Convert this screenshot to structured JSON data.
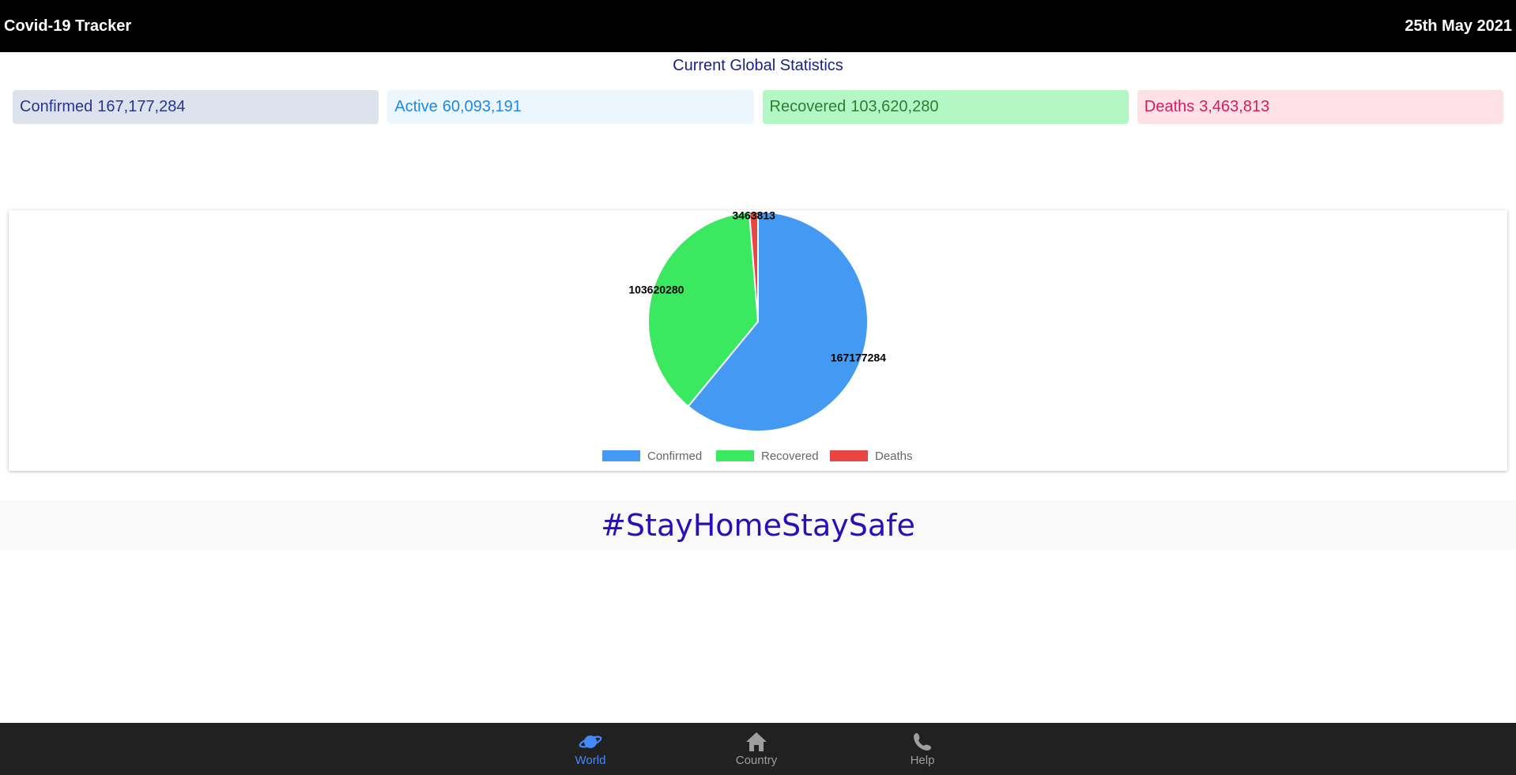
{
  "header": {
    "title": "Covid-19 Tracker",
    "date": "25th May 2021"
  },
  "stats": {
    "title": "Current Global Statistics",
    "cards": [
      {
        "label": "Confirmed",
        "value": "167,177,284",
        "bg": "#dde3ec",
        "color": "#283593"
      },
      {
        "label": "Active",
        "value": "60,093,191",
        "bg": "#eef6fd",
        "color": "#1e88e5"
      },
      {
        "label": "Recovered",
        "value": "103,620,280",
        "bg": "#b2f7c4",
        "color": "#2e7d32"
      },
      {
        "label": "Deaths",
        "value": "3,463,813",
        "bg": "#fde1e6",
        "color": "#d81b60"
      }
    ]
  },
  "chart_data": {
    "type": "pie",
    "categories": [
      "Confirmed",
      "Recovered",
      "Deaths"
    ],
    "values": [
      167177284,
      103620280,
      3463813
    ],
    "data_labels": [
      "167177284",
      "103620280",
      "3463813"
    ],
    "colors": [
      "#4499f3",
      "#3be961",
      "#ea4545"
    ],
    "legend": "bottom"
  },
  "banner": {
    "text": "#StayHomeStaySafe"
  },
  "nav": {
    "active_color": "#448aff",
    "inactive_color": "#9e9e9e",
    "items": [
      {
        "label": "World",
        "icon": "planet-icon",
        "active": true
      },
      {
        "label": "Country",
        "icon": "home-icon",
        "active": false
      },
      {
        "label": "Help",
        "icon": "phone-icon",
        "active": false
      }
    ]
  }
}
